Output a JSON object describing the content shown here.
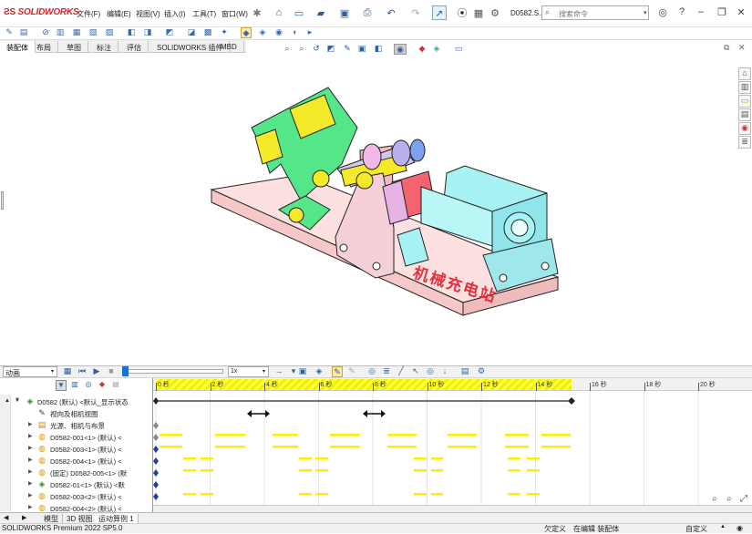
{
  "app": {
    "brand": "SOLIDWORKS",
    "menu": [
      "文件(F)",
      "编辑(E)",
      "视图(V)",
      "插入(I)",
      "工具(T)",
      "窗口(W)"
    ],
    "doc_name": "D0582.S...",
    "search_placeholder": "搜索命令"
  },
  "cmd_tabs": [
    "装配体",
    "布局",
    "草图",
    "标注",
    "评估",
    "SOLIDWORKS 插件",
    "MBD"
  ],
  "viewport": {
    "watermark": "机械充电站"
  },
  "motion": {
    "study_type": "动画",
    "speed": "1x",
    "ruler_labels": [
      "0 秒",
      "2 秒",
      "4 秒",
      "6 秒",
      "8 秒",
      "10 秒",
      "12 秒",
      "14 秒",
      "16 秒",
      "18 秒",
      "20 秒"
    ],
    "playhead_color": "#1f6fcf",
    "key_color": "#ffee00"
  },
  "tree": {
    "items": [
      {
        "label": "D0582 (默认) <默认_显示状态",
        "icon": "assembly-icon",
        "expand": "▼"
      },
      {
        "label": "视向及相机视图",
        "icon": "camera-icon",
        "expand": ""
      },
      {
        "label": "光源、相机与布景",
        "icon": "light-icon",
        "expand": "▶"
      },
      {
        "label": "D0582-001<1> (默认) <",
        "icon": "part-icon",
        "expand": "▶"
      },
      {
        "label": "D0582-003<1> (默认) <",
        "icon": "part-icon",
        "expand": "▶"
      },
      {
        "label": "D0582-004<1> (默认) <",
        "icon": "part-icon",
        "expand": "▶"
      },
      {
        "label": "(固定) D0582-005<1> (默认",
        "icon": "part-icon",
        "expand": "▶"
      },
      {
        "label": "D0582-01<1> (默认) <默",
        "icon": "subassembly-icon",
        "expand": "▶"
      },
      {
        "label": "D0582-003<2> (默认) <",
        "icon": "part-icon",
        "expand": "▶"
      },
      {
        "label": "D0582-004<2> (默认) <",
        "icon": "part-icon",
        "expand": "▶"
      }
    ]
  },
  "bottom_tabs": [
    "模型",
    "3D 视图",
    "运动算例 1"
  ],
  "status": {
    "product": "SOLIDWORKS Premium 2022 SP5.0",
    "under_defined": "欠定义",
    "editing": "在编辑 装配体",
    "custom": "自定义"
  }
}
